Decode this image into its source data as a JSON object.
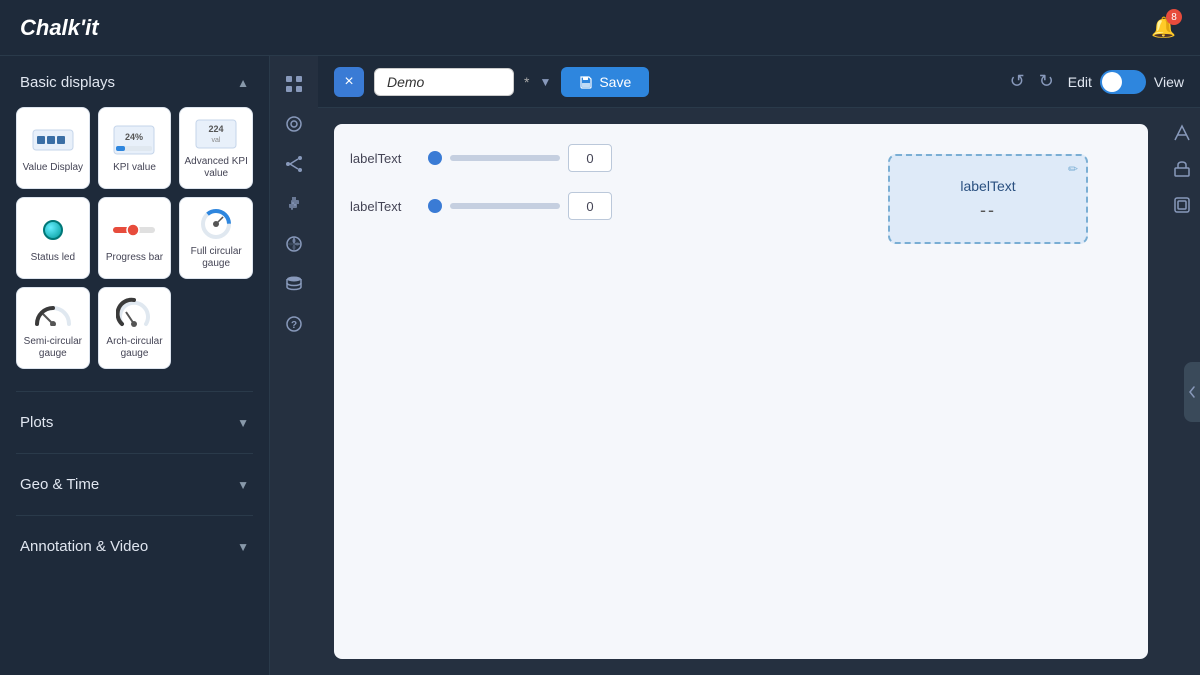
{
  "app": {
    "name": "Chalk'it",
    "notification_count": "8"
  },
  "toolbar": {
    "close_label": "×",
    "demo_value": "Demo",
    "asterisk": "*",
    "save_label": "Save",
    "undo_label": "↺",
    "redo_label": "↻",
    "edit_label": "Edit",
    "view_label": "View"
  },
  "sidebar": {
    "sections": [
      {
        "id": "basic-displays",
        "label": "Basic displays",
        "expanded": true,
        "widgets": [
          {
            "id": "value-display",
            "label": "Value Display"
          },
          {
            "id": "kpi-value",
            "label": "KPI value"
          },
          {
            "id": "advanced-kpi",
            "label": "Advanced KPI value"
          },
          {
            "id": "status-led",
            "label": "Status led"
          },
          {
            "id": "progress-bar",
            "label": "Progress bar"
          },
          {
            "id": "full-circular-gauge",
            "label": "Full circular gauge"
          },
          {
            "id": "semi-circular-gauge",
            "label": "Semi-circular gauge"
          },
          {
            "id": "arch-circular-gauge",
            "label": "Arch-circular gauge"
          }
        ]
      },
      {
        "id": "plots",
        "label": "Plots",
        "expanded": false
      },
      {
        "id": "geo-time",
        "label": "Geo & Time",
        "expanded": false
      },
      {
        "id": "annotation-video",
        "label": "Annotation & Video",
        "expanded": false
      }
    ]
  },
  "canvas": {
    "rows": [
      {
        "label": "labelText",
        "value": "0"
      },
      {
        "label": "labelText",
        "value": "0"
      }
    ],
    "selected_widget": {
      "title": "labelText",
      "value": "--"
    }
  },
  "center_icons": [
    {
      "id": "grid-icon",
      "symbol": "⊞"
    },
    {
      "id": "layers-icon",
      "symbol": "◎"
    },
    {
      "id": "connect-icon",
      "symbol": "⚡"
    },
    {
      "id": "puzzle-icon",
      "symbol": "🧩"
    },
    {
      "id": "palette-icon",
      "symbol": "🎨"
    },
    {
      "id": "db-icon",
      "symbol": "🗄"
    },
    {
      "id": "help-icon",
      "symbol": "?"
    }
  ]
}
